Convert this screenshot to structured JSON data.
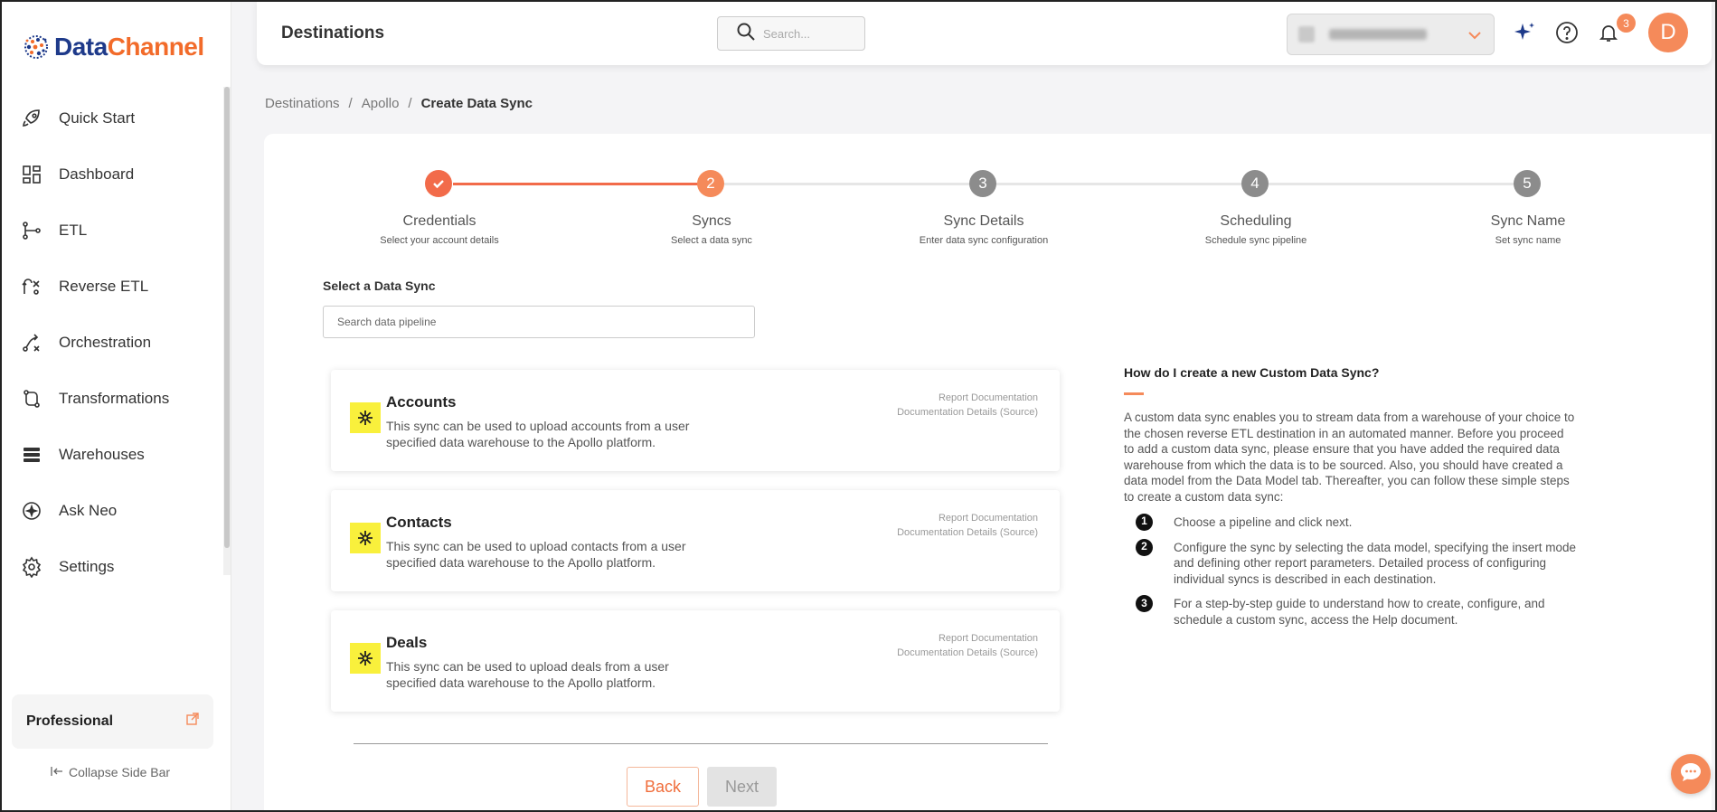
{
  "brand": {
    "name_part1": "Data",
    "name_part2": "Channel",
    "primary_color": "#1e3a8a",
    "accent_color": "#f26b2a"
  },
  "sidebar": {
    "items": [
      {
        "label": "Quick Start",
        "icon": "rocket-icon"
      },
      {
        "label": "Dashboard",
        "icon": "dashboard-icon"
      },
      {
        "label": "ETL",
        "icon": "etl-icon"
      },
      {
        "label": "Reverse ETL",
        "icon": "reverse-etl-icon"
      },
      {
        "label": "Orchestration",
        "icon": "orchestration-icon"
      },
      {
        "label": "Transformations",
        "icon": "transformations-icon"
      },
      {
        "label": "Warehouses",
        "icon": "warehouses-icon"
      },
      {
        "label": "Ask Neo",
        "icon": "sparkle-icon"
      },
      {
        "label": "Settings",
        "icon": "gear-icon"
      }
    ],
    "plan": "Professional",
    "collapse_label": "Collapse Side Bar"
  },
  "header": {
    "title": "Destinations",
    "search_placeholder": "Search...",
    "notification_count": "3",
    "avatar_initial": "D"
  },
  "breadcrumb": {
    "items": [
      "Destinations",
      "Apollo"
    ],
    "current": "Create Data Sync"
  },
  "stepper": {
    "steps": [
      {
        "number": "✓",
        "title": "Credentials",
        "subtitle": "Select your account details",
        "state": "done"
      },
      {
        "number": "2",
        "title": "Syncs",
        "subtitle": "Select a data sync",
        "state": "active"
      },
      {
        "number": "3",
        "title": "Sync Details",
        "subtitle": "Enter data sync configuration",
        "state": "pending"
      },
      {
        "number": "4",
        "title": "Scheduling",
        "subtitle": "Schedule sync pipeline",
        "state": "pending"
      },
      {
        "number": "5",
        "title": "Sync Name",
        "subtitle": "Set sync name",
        "state": "pending"
      }
    ]
  },
  "main": {
    "select_label": "Select a Data Sync",
    "search_placeholder": "Search data pipeline",
    "cards": [
      {
        "title": "Accounts",
        "description": "This sync can be used to upload accounts from a user specified data warehouse to the Apollo platform.",
        "link1": "Report Documentation",
        "link2": "Documentation Details (Source)"
      },
      {
        "title": "Contacts",
        "description": "This sync can be used to upload contacts from a user specified data warehouse to the Apollo platform.",
        "link1": "Report Documentation",
        "link2": "Documentation Details (Source)"
      },
      {
        "title": "Deals",
        "description": "This sync can be used to upload deals from a user specified data warehouse to the Apollo platform.",
        "link1": "Report Documentation",
        "link2": "Documentation Details (Source)"
      }
    ],
    "back_label": "Back",
    "next_label": "Next"
  },
  "help": {
    "title": "How do I create a new Custom Data Sync?",
    "body": "A custom data sync enables you to stream data from a warehouse of your choice to the chosen reverse ETL destination in an automated manner. Before you proceed to add a custom data sync, please ensure that you have added the required data warehouse from which the data is to be sourced. Also, you should have created a data model from the Data Model tab. Thereafter, you can follow these simple steps to create a custom data sync:",
    "steps": [
      {
        "n": "1",
        "text": "Choose a pipeline and click next."
      },
      {
        "n": "2",
        "text": "Configure the sync by selecting the data model, specifying the insert mode and defining other report parameters. Detailed process of configuring individual syncs is described in each destination."
      },
      {
        "n": "3",
        "text": "For a step-by-step guide to understand how to create, configure, and schedule a custom sync, access the Help document."
      }
    ]
  },
  "colors": {
    "orange": "#f58a5a",
    "step_done": "#f26b4a",
    "step_pending": "#8c8c8c",
    "card_icon_bg": "#f9f03c"
  }
}
